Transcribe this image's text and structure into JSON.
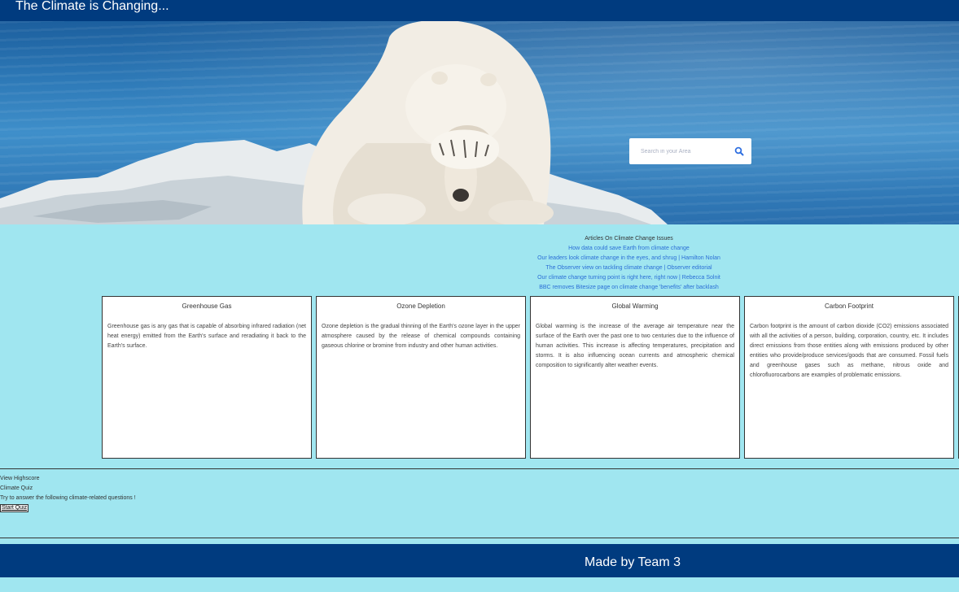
{
  "header": {
    "title": "The Climate is Changing..."
  },
  "hero": {
    "image_name": "polar-bear-facepalm-on-ice-floe",
    "search": {
      "placeholder": "Search in your Area",
      "value": ""
    }
  },
  "articles": {
    "heading": "Articles On Climate Change Issues",
    "links": [
      "How data could save Earth from climate change",
      "Our leaders look climate change in the eyes, and shrug | Hamilton Nolan",
      "The Observer view on tackling climate change | Observer editorial",
      "Our climate change turning point is right here, right now | Rebecca Solnit",
      "BBC removes Bitesize page on climate change 'benefits' after backlash"
    ]
  },
  "cards": [
    {
      "title": "Greenhouse Gas",
      "body": "Greenhouse gas is any gas that is capable of absorbing infrared radiation (net heat energy) emitted from the Earth's surface and reradiating it back to the Earth's surface."
    },
    {
      "title": "Ozone Depletion",
      "body": "Ozone depletion is the gradual thinning of the Earth's ozone layer in the upper atmosphere caused by the release of chemical compounds containing gaseous chlorine or bromine from industry and other human activities."
    },
    {
      "title": "Global Warming",
      "body": "Global warming is the increase of the average air temperature near the surface of the Earth over the past one to two centuries due to the influence of human activities. This increase is affecting temperatures, precipitation and storms. It is also influencing ocean currents and atmospheric chemical composition to significantly alter weather events."
    },
    {
      "title": "Carbon Footprint",
      "body": "Carbon footprint is the amount of carbon dioxide (CO2) emissions associated with all the activities of a person, building, corporation, country, etc. It includes direct emissions from those entities along with emissions produced by other entities who provide/produce services/goods that are consumed. Fossil fuels and greenhouse gases such as methane, nitrous oxide and chlorofluorocarbons are examples of problematic emissions."
    }
  ],
  "quiz": {
    "highscore_label": "View Highscore",
    "title": "Climate Quiz",
    "description": "Try to answer the following climate-related questions !",
    "start_label": "Start Quiz"
  },
  "footer": {
    "text": "Made by Team 3"
  },
  "colors": {
    "navbar": "#003b7f",
    "background": "#a0e6f0",
    "link": "#2b6fd6",
    "search_icon": "#2f6fe0"
  }
}
